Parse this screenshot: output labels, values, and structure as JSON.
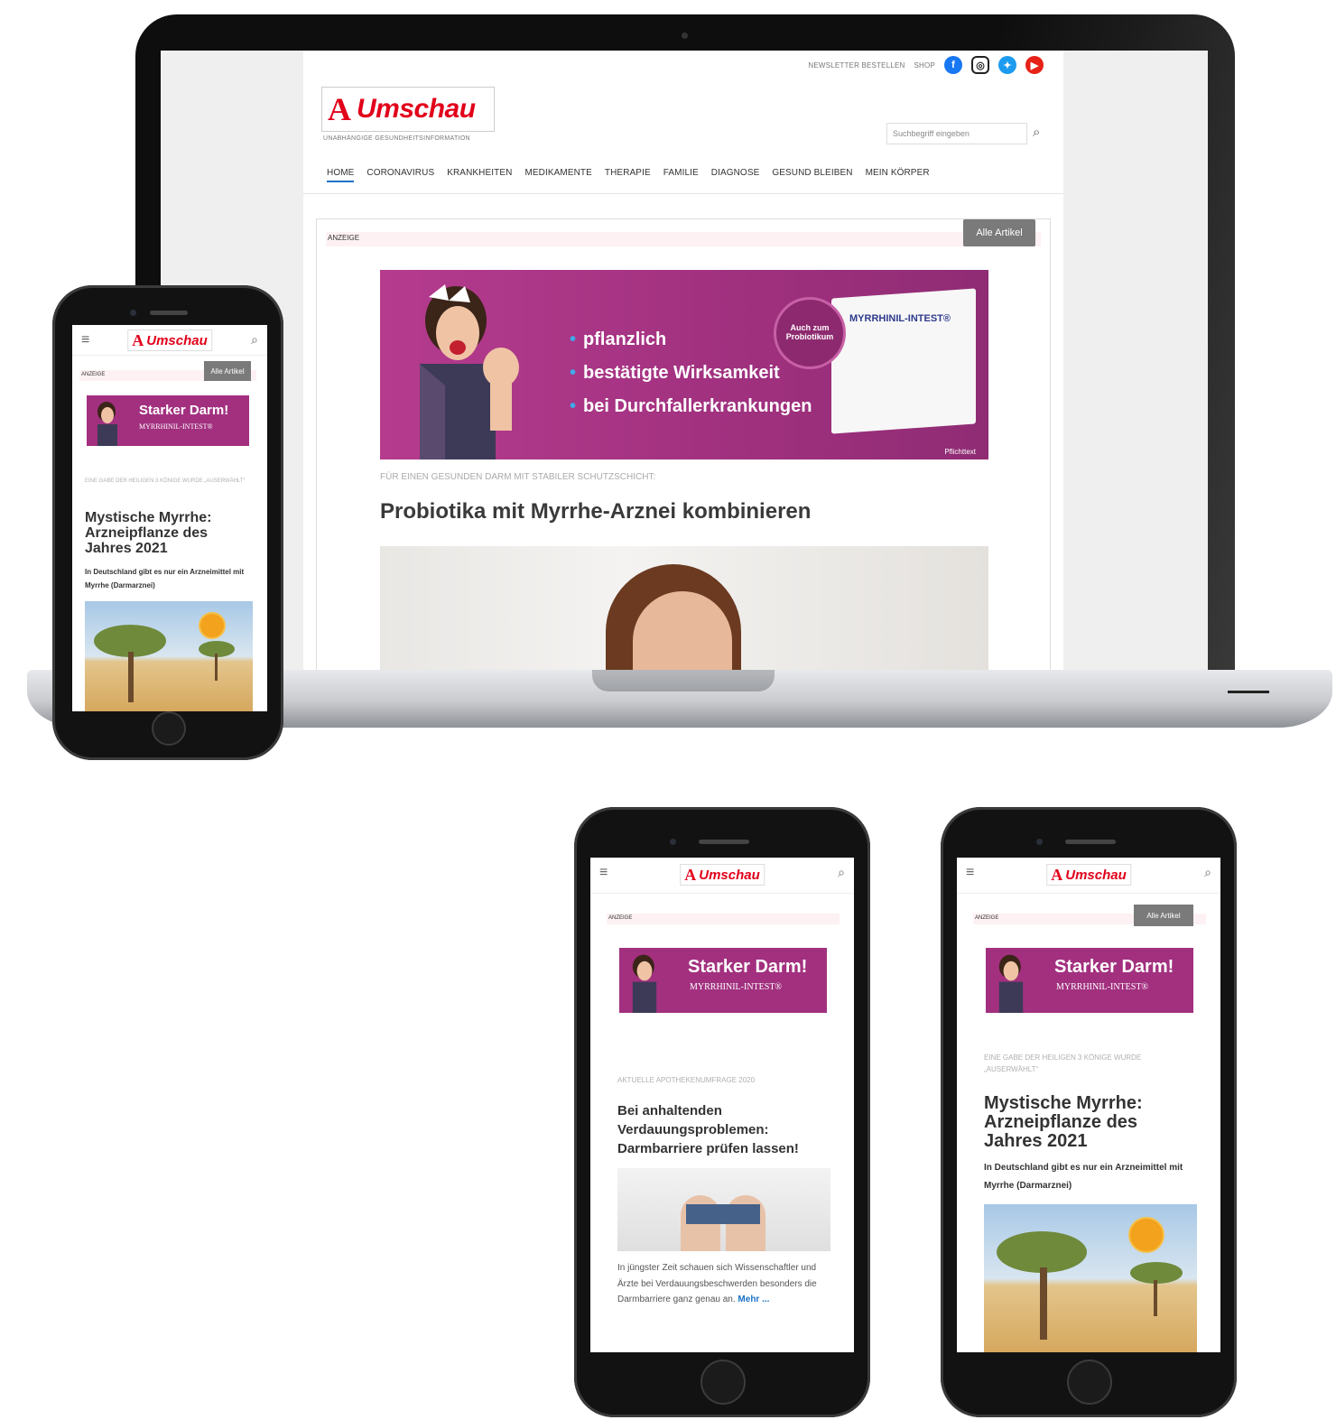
{
  "laptop": {
    "top_links": {
      "newsletter": "NEWSLETTER BESTELLEN",
      "shop": "SHOP"
    },
    "social_icons": [
      "facebook-icon",
      "instagram-icon",
      "twitter-icon",
      "youtube-icon"
    ],
    "logo": {
      "brand": "Umschau",
      "tagline": "UNABHÄNGIGE GESUNDHEITSINFORMATION"
    },
    "search": {
      "placeholder": "Suchbegriff eingeben"
    },
    "nav": [
      "HOME",
      "CORONAVIRUS",
      "KRANKHEITEN",
      "MEDIKAMENTE",
      "THERAPIE",
      "FAMILIE",
      "DIAGNOSE",
      "GESUND BLEIBEN",
      "MEIN KÖRPER"
    ],
    "ad_label": "ANZEIGE",
    "all_articles": "Alle Artikel",
    "banner": {
      "bullets": [
        "pflanzlich",
        "bestätigte Wirksamkeit",
        "bei Durchfallerkrankungen"
      ],
      "circle": "Auch zum Probiotikum",
      "product": "MYRRHINIL-INTEST®",
      "pflicht": "Pflichttext"
    },
    "kicker": "FÜR EINEN GESUNDEN DARM MIT STABILER SCHUTZSCHICHT:",
    "headline": "Probiotika mit Myrrhe-Arznei kombinieren"
  },
  "phone_common": {
    "brand": "Umschau",
    "ad_label": "ANZEIGE",
    "all_articles": "Alle Artikel",
    "banner_title": "Starker Darm!",
    "banner_sub": "MYRRHINIL-INTEST®"
  },
  "phone_myrrhe": {
    "kicker": "EINE GABE DER HEILIGEN 3 KÖNIGE WURDE „AUSERWÄHLT“",
    "title": "Mystische Myrrhe: Arzneipflanze des Jahres 2021",
    "lead": "In Deutschland gibt es nur ein Arzneimittel mit Myrrhe (Darmarznei)"
  },
  "phone_darm": {
    "kicker": "AKTUELLE APOTHEKENUMFRAGE 2020",
    "title": "Bei anhaltenden Verdauungsproblemen: Darmbarriere prüfen lassen!",
    "body": "In jüngster Zeit schauen sich Wissenschaftler und Ärzte bei Verdauungsbeschwerden besonders die Darmbarriere ganz genau an.",
    "more": "Mehr ..."
  },
  "colors": {
    "brand_red": "#e2001a",
    "banner_purple": "#a2307f",
    "link_blue": "#1a73c8"
  }
}
